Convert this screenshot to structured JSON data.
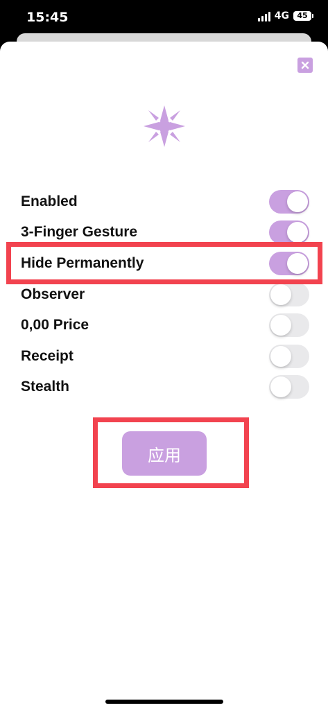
{
  "status_bar": {
    "time": "15:45",
    "network": "4G",
    "battery": "45"
  },
  "icons": {
    "close": "close-icon",
    "logo": "star-burst-icon"
  },
  "colors": {
    "accent": "#c9a0e0",
    "highlight": "#f2434f",
    "toggle_off": "#e9e9eb"
  },
  "settings": [
    {
      "label": "Enabled",
      "on": true
    },
    {
      "label": "3-Finger Gesture",
      "on": true
    },
    {
      "label": "Hide Permanently",
      "on": true
    },
    {
      "label": "Observer",
      "on": false
    },
    {
      "label": "0,00 Price",
      "on": false
    },
    {
      "label": "Receipt",
      "on": false
    },
    {
      "label": "Stealth",
      "on": false
    }
  ],
  "apply_label": "应用"
}
